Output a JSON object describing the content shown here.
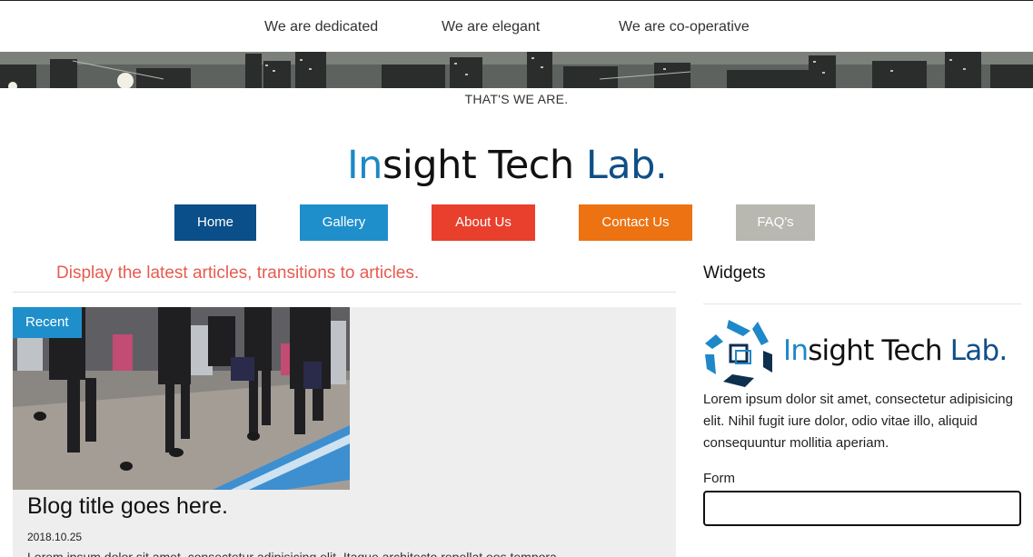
{
  "taglines": [
    "We are dedicated",
    "We are elegant",
    "We are co-operative"
  ],
  "subtitle": "THAT'S WE ARE.",
  "brand": {
    "part1": "In",
    "part2": "sight Tech ",
    "part3": "Lab.",
    "colors": {
      "accent": "#1e88c8",
      "dark": "#111111",
      "navy": "#0f4f87"
    }
  },
  "nav": [
    {
      "label": "Home",
      "color": "#0a4e8a"
    },
    {
      "label": "Gallery",
      "color": "#1f8fcb"
    },
    {
      "label": "About Us",
      "color": "#e8402d"
    },
    {
      "label": "Contact Us",
      "color": "#ed7211"
    },
    {
      "label": "FAQ's",
      "color": "#b8b8b0"
    }
  ],
  "main": {
    "heading": "Display the latest articles, transitions to articles.",
    "article": {
      "badge": "Recent",
      "title": "Blog title goes here.",
      "date": "2018.10.25",
      "excerpt": "Lorem ipsum dolor sit amet, consectetur adipisicing elit. Itaque architecto repellat eos tempora"
    }
  },
  "sidebar": {
    "title": "Widgets",
    "logo_icon": "hexagon-logo-icon",
    "text": "Lorem ipsum dolor sit amet, consectetur adipisicing elit. Nihil fugit iure dolor, odio vitae illo, aliquid consequuntur mollitia aperiam.",
    "form_label": "Form",
    "form_value": ""
  }
}
